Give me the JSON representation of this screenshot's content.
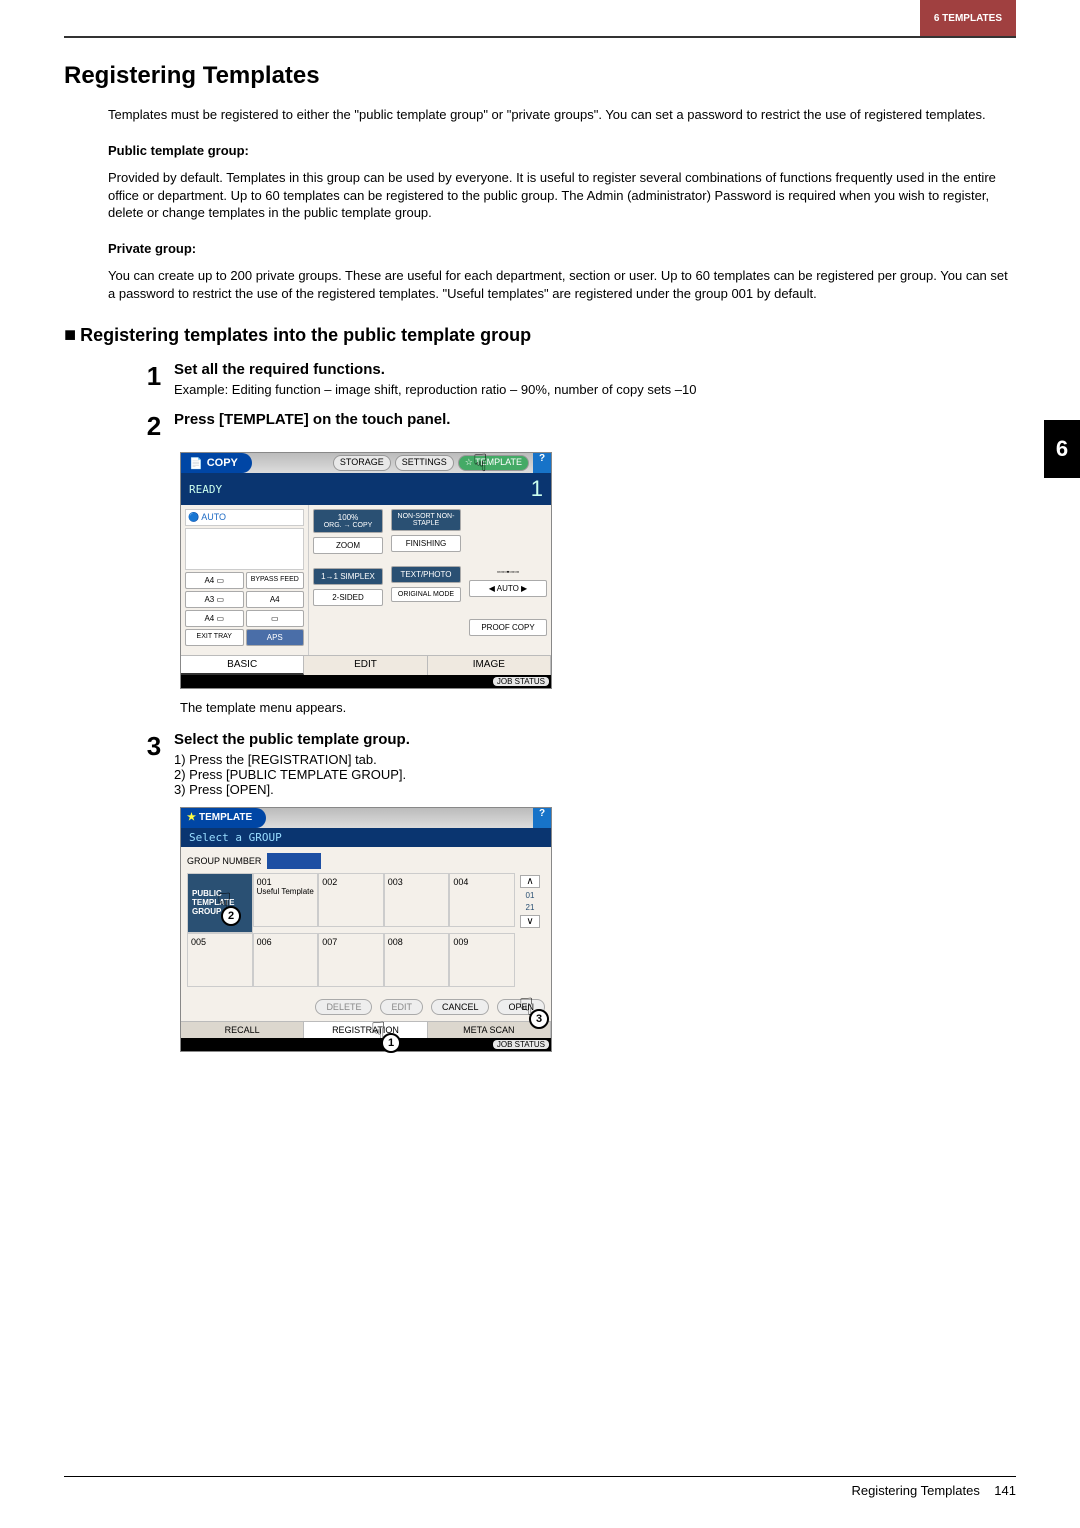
{
  "header": {
    "section": "6 TEMPLATES"
  },
  "chapter_number": "6",
  "title": "Registering Templates",
  "intro": "Templates must be registered to either the \"public template group\" or \"private groups\". You can set a password to restrict the use of registered templates.",
  "public_group_heading": "Public template group:",
  "public_group_text": "Provided by default. Templates in this group can be used by everyone. It is useful to register several combinations of functions frequently used in the entire office or department. Up to 60 templates can be registered to the public group. The Admin (administrator) Password is required when you wish to register, delete or change templates in the public template group.",
  "private_group_heading": "Private group:",
  "private_group_text": "You can create up to 200 private groups. These are useful for each department, section or user. Up to 60 templates can be registered per group. You can set a password to restrict the use of the registered templates. \"Useful templates\" are registered under the group 001 by default.",
  "section_heading": "Registering templates into the public template group",
  "steps": {
    "s1": {
      "num": "1",
      "title": "Set all the required functions.",
      "text": "Example: Editing function – image shift, reproduction ratio – 90%, number of copy sets –10"
    },
    "s2": {
      "num": "2",
      "title": "Press [TEMPLATE] on the touch panel.",
      "after": "The template menu appears."
    },
    "s3": {
      "num": "3",
      "title": "Select the public template group.",
      "sub1": "1)  Press the [REGISTRATION] tab.",
      "sub2": "2)  Press [PUBLIC TEMPLATE GROUP].",
      "sub3": "3)  Press [OPEN]."
    }
  },
  "copy_panel": {
    "title": "COPY",
    "top_buttons": {
      "storage": "STORAGE",
      "settings": "SETTINGS",
      "template": "TEMPLATE"
    },
    "help": "?",
    "ready": "READY",
    "count": "1",
    "auto": "AUTO",
    "trays": {
      "a4_1": "A4",
      "a3": "A3",
      "a4_2": "A4",
      "a4_3": "A4",
      "bypass": "BYPASS FEED"
    },
    "buttons": {
      "ratio": "100%",
      "orgcopy": "ORG. → COPY",
      "zoom": "ZOOM",
      "simplex": "1→1 SIMPLEX",
      "twosided": "2-SIDED",
      "nonsort": "NON-SORT NON-STAPLE",
      "finishing": "FINISHING",
      "textphoto": "TEXT/PHOTO",
      "original": "ORIGINAL MODE",
      "autobtn": "AUTO",
      "proof": "PROOF COPY",
      "exit": "EXIT TRAY",
      "aps": "APS"
    },
    "tabs": {
      "basic": "BASIC",
      "edit": "EDIT",
      "image": "IMAGE"
    },
    "jobstatus": "JOB STATUS"
  },
  "tmpl_panel": {
    "title": "TEMPLATE",
    "help": "?",
    "subtitle": "Select a GROUP",
    "group_number_label": "GROUP NUMBER",
    "ptg": "PUBLIC TEMPLATE GROUP",
    "cells": {
      "c001n": "001",
      "c001t": "Useful Template",
      "c002": "002",
      "c003": "003",
      "c004": "004",
      "c005": "005",
      "c006": "006",
      "c007": "007",
      "c008": "008",
      "c009": "009"
    },
    "side": {
      "up": "∧",
      "p1": "01",
      "p2": "21",
      "down": "∨"
    },
    "btns": {
      "delete": "DELETE",
      "edit": "EDIT",
      "cancel": "CANCEL",
      "open": "OPEN"
    },
    "tabs": {
      "recall": "RECALL",
      "registration": "REGISTRATION",
      "metascan": "META SCAN"
    },
    "jobstatus": "JOB STATUS"
  },
  "callouts": {
    "c1": "1",
    "c2": "2",
    "c3": "3"
  },
  "footer": {
    "title": "Registering Templates",
    "page": "141"
  }
}
